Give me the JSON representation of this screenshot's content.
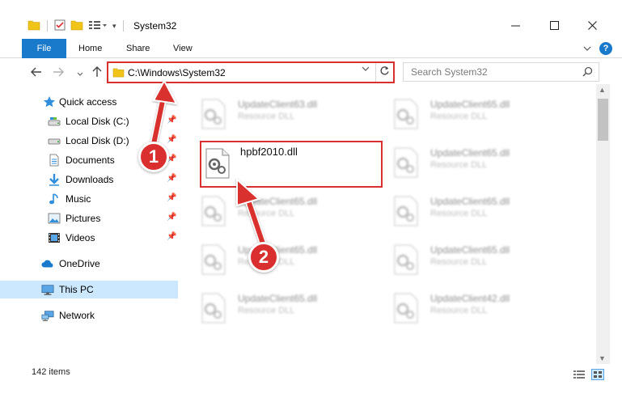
{
  "window": {
    "title": "System32",
    "controls": [
      "minimize-icon",
      "maximize-icon",
      "close-icon"
    ]
  },
  "ribbon": {
    "tabs": [
      "File",
      "Home",
      "Share",
      "View"
    ],
    "help": "?"
  },
  "address": {
    "path": "C:\\Windows\\System32",
    "search_placeholder": "Search System32"
  },
  "nav": {
    "quick_access": "Quick access",
    "items": [
      {
        "label": "Local Disk (C:)",
        "icon": "drive-icon",
        "pinned": true
      },
      {
        "label": "Local Disk (D:)",
        "icon": "drive-icon",
        "pinned": true
      },
      {
        "label": "Documents",
        "icon": "documents-icon",
        "pinned": true
      },
      {
        "label": "Downloads",
        "icon": "downloads-icon",
        "pinned": true
      },
      {
        "label": "Music",
        "icon": "music-icon",
        "pinned": true
      },
      {
        "label": "Pictures",
        "icon": "pictures-icon",
        "pinned": true
      },
      {
        "label": "Videos",
        "icon": "videos-icon",
        "pinned": true
      }
    ],
    "onedrive": "OneDrive",
    "this_pc": "This PC",
    "network": "Network"
  },
  "files": {
    "target": {
      "name": "hpbf2010.dll"
    },
    "left_column": [
      {
        "name": "UpdateClient63.dll",
        "type": "Resource DLL"
      },
      {
        "name": "UpdateClient65.dll",
        "type": "Resource DLL"
      },
      {
        "name": "UpdateClient65.dll",
        "type": "Resource DLL"
      },
      {
        "name": "UpdateClient65.dll",
        "type": "Resource DLL"
      }
    ],
    "right_column": [
      {
        "name": "UpdateClient65.dll",
        "type": "Resource DLL"
      },
      {
        "name": "UpdateClient65.dll",
        "type": "Resource DLL"
      },
      {
        "name": "UpdateClient65.dll",
        "type": "Resource DLL"
      },
      {
        "name": "UpdateClient65.dll",
        "type": "Resource DLL"
      },
      {
        "name": "UpdateClient42.dll",
        "type": "Resource DLL"
      }
    ]
  },
  "status": {
    "item_count": "142 items"
  },
  "annotations": {
    "step1": "1",
    "step2": "2",
    "color": "#d9302f"
  },
  "colors": {
    "accent": "#1979ca",
    "selection": "#cce8ff",
    "annotation": "#d9302f"
  }
}
